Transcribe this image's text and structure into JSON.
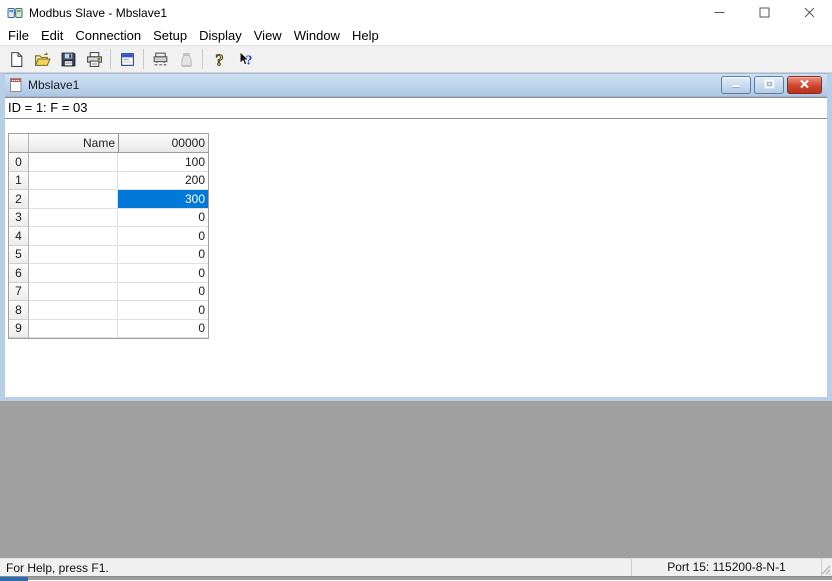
{
  "titlebar": {
    "title": "Modbus Slave - Mbslave1",
    "controls": [
      "minimize",
      "maximize",
      "close"
    ]
  },
  "menubar": {
    "items": [
      "File",
      "Edit",
      "Connection",
      "Setup",
      "Display",
      "View",
      "Window",
      "Help"
    ]
  },
  "toolbar": {
    "items": [
      {
        "type": "button",
        "name": "new-file",
        "icon": "new-file"
      },
      {
        "type": "button",
        "name": "open-file",
        "icon": "open-folder"
      },
      {
        "type": "button",
        "name": "save",
        "icon": "floppy-disk"
      },
      {
        "type": "button",
        "name": "print",
        "icon": "printer"
      },
      {
        "type": "separator"
      },
      {
        "type": "button",
        "name": "slave-definition",
        "icon": "setup-window"
      },
      {
        "type": "separator"
      },
      {
        "type": "button",
        "name": "communication-traffic",
        "icon": "serial-device"
      },
      {
        "type": "button",
        "name": "display-communication",
        "icon": "device-disabled",
        "disabled": true
      },
      {
        "type": "separator"
      },
      {
        "type": "button",
        "name": "about-help",
        "icon": "question-mark"
      },
      {
        "type": "button",
        "name": "context-help",
        "icon": "arrow-question"
      }
    ]
  },
  "child_window": {
    "title": "Mbslave1",
    "status_line": "ID = 1: F = 03",
    "controls": [
      "minimize",
      "restore",
      "close"
    ]
  },
  "grid": {
    "columns": [
      "",
      "Name",
      "00000"
    ],
    "rows": [
      {
        "index": "0",
        "name": "",
        "value": "100"
      },
      {
        "index": "1",
        "name": "",
        "value": "200"
      },
      {
        "index": "2",
        "name": "",
        "value": "300"
      },
      {
        "index": "3",
        "name": "",
        "value": "0"
      },
      {
        "index": "4",
        "name": "",
        "value": "0"
      },
      {
        "index": "5",
        "name": "",
        "value": "0"
      },
      {
        "index": "6",
        "name": "",
        "value": "0"
      },
      {
        "index": "7",
        "name": "",
        "value": "0"
      },
      {
        "index": "8",
        "name": "",
        "value": "0"
      },
      {
        "index": "9",
        "name": "",
        "value": "0"
      }
    ],
    "selection": {
      "row": 2,
      "column": "00000"
    }
  },
  "statusbar": {
    "left": "For Help, press F1.",
    "right": "Port 15: 115200-8-N-1"
  },
  "colors": {
    "selection_blue": "#0078d7",
    "child_titlebar_blue": "#bdd4ee",
    "child_frame_blue": "#b9cfe8",
    "mdi_gray": "#a0a0a0",
    "close_button_red": "#d0452f",
    "frame_accent_blue": "#2b6cb8"
  }
}
